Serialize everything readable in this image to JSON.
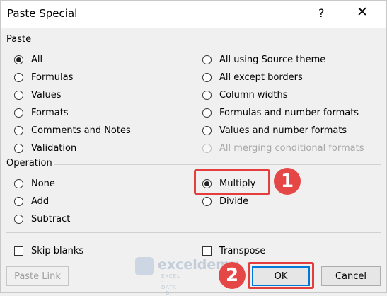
{
  "dialog": {
    "title": "Paste Special",
    "help_label": "?",
    "close_label": "✕"
  },
  "paste_section": {
    "label": "Paste",
    "left_options": [
      {
        "label": "All",
        "selected": true
      },
      {
        "label": "Formulas",
        "selected": false
      },
      {
        "label": "Values",
        "selected": false
      },
      {
        "label": "Formats",
        "selected": false
      },
      {
        "label": "Comments and Notes",
        "selected": false
      },
      {
        "label": "Validation",
        "selected": false
      }
    ],
    "right_options": [
      {
        "label": "All using Source theme",
        "selected": false
      },
      {
        "label": "All except borders",
        "selected": false
      },
      {
        "label": "Column widths",
        "selected": false
      },
      {
        "label": "Formulas and number formats",
        "selected": false
      },
      {
        "label": "Values and number formats",
        "selected": false
      },
      {
        "label": "All merging conditional formats",
        "selected": false,
        "disabled": true
      }
    ]
  },
  "operation_section": {
    "label": "Operation",
    "left_options": [
      {
        "label": "None",
        "selected": false
      },
      {
        "label": "Add",
        "selected": false
      },
      {
        "label": "Subtract",
        "selected": false
      }
    ],
    "right_options": [
      {
        "label": "Multiply",
        "selected": true
      },
      {
        "label": "Divide",
        "selected": false
      }
    ]
  },
  "checkboxes": {
    "skip_blanks": {
      "label": "Skip blanks",
      "checked": false
    },
    "transpose": {
      "label": "Transpose",
      "checked": false
    }
  },
  "buttons": {
    "paste_link": "Paste Link",
    "ok": "OK",
    "cancel": "Cancel"
  },
  "annotations": {
    "step1": "1",
    "step2": "2",
    "highlight_color": "#e43d3d"
  },
  "watermark": {
    "name": "exceldemy",
    "tagline": "EXCEL · DATA · BI"
  }
}
